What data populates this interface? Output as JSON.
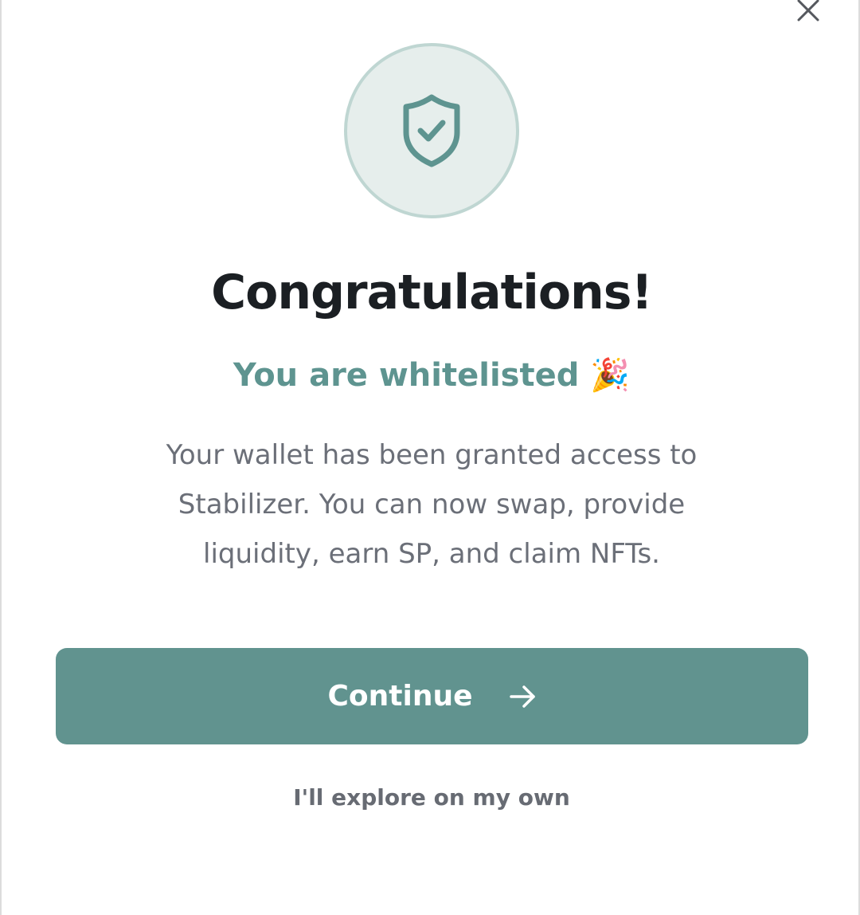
{
  "modal": {
    "title": "Congratulations!",
    "subtitle": "You are whitelisted 🎉",
    "body": "Your wallet has been granted access to Stabilizer. You can now swap, provide liquidity, earn SP, and claim NFTs.",
    "continue_label": "Continue",
    "explore_label": "I'll explore on my own",
    "icons": {
      "close": "close-icon",
      "hero": "shield-check-icon",
      "continue": "arrow-right-icon"
    }
  },
  "colors": {
    "accent": "#61938f",
    "accent_light": "#e6eeec",
    "title": "#1b1f23",
    "body": "#6b6f78"
  }
}
